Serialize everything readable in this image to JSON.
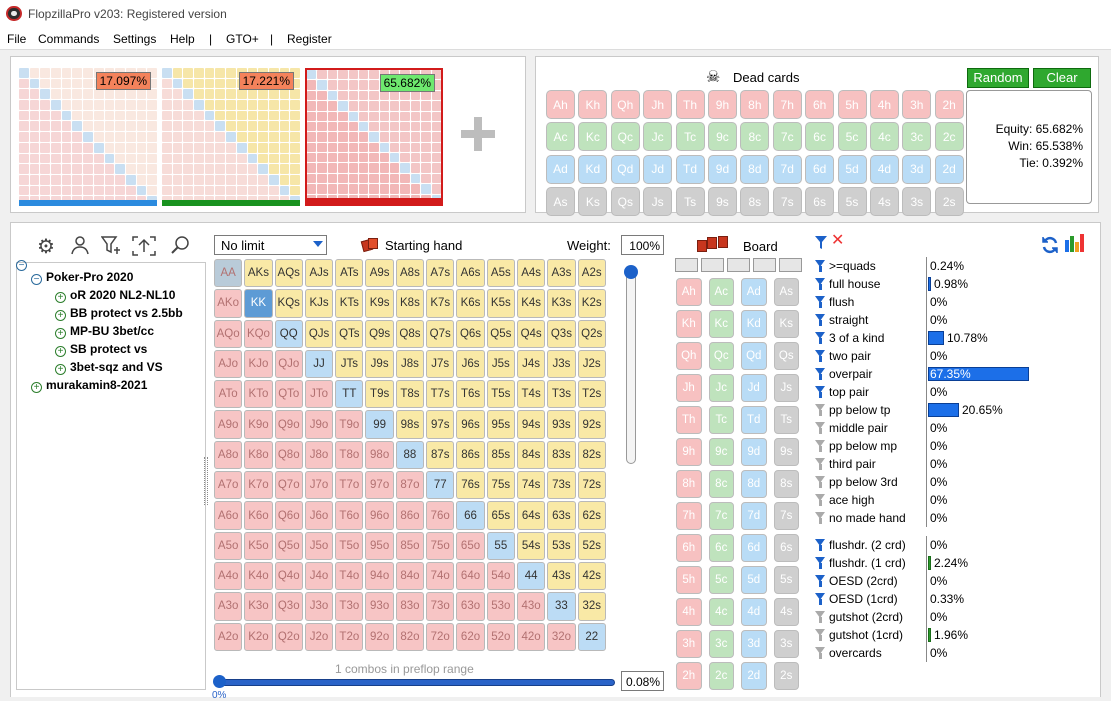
{
  "app": {
    "title": "FlopzillaPro v203: Registered version"
  },
  "menu": [
    "File",
    "Commands",
    "Settings",
    "Help",
    "|",
    "GTO+",
    "|",
    "Register"
  ],
  "ranges": [
    {
      "pct": "17.097%",
      "pct_bg": "#f4825b",
      "bar_color": "#2b8bdf"
    },
    {
      "pct": "17.221%",
      "pct_bg": "#f4825b",
      "bar_color": "#19921f"
    },
    {
      "pct": "65.682%",
      "pct_bg": "#6ee86e",
      "bar_color": "#d21b1b"
    }
  ],
  "dead_cards": {
    "title": "Dead cards",
    "random": "Random",
    "clear": "Clear",
    "ranks": [
      "A",
      "K",
      "Q",
      "J",
      "T",
      "9",
      "8",
      "7",
      "6",
      "5",
      "4",
      "3",
      "2"
    ],
    "suits": [
      "h",
      "c",
      "d",
      "s"
    ]
  },
  "equity": {
    "equity": "Equity: 65.682%",
    "win": "Win: 65.538%",
    "tie": "Tie: 0.392%"
  },
  "tree": {
    "items": [
      {
        "label": "Poker-Pro 2020",
        "expanded": true
      },
      {
        "label": "oR 2020 NL2-NL10"
      },
      {
        "label": "BB protect vs 2.5bb"
      },
      {
        "label": "MP-BU 3bet/cc"
      },
      {
        "label": "SB protect vs"
      },
      {
        "label": "3bet-sqz and VS"
      },
      {
        "label": "murakamin8-2021"
      }
    ]
  },
  "limit": {
    "value": "No limit"
  },
  "starting_hand": {
    "title": "Starting hand",
    "weight_label": "Weight:",
    "weight": "100%",
    "combos": "1 combos in preflop range",
    "zoom": "0.08%",
    "slider": "0%"
  },
  "board": {
    "title": "Board"
  },
  "stats": [
    {
      "name": ">=quads",
      "value": "0.24%",
      "pct": 0.24,
      "active": true
    },
    {
      "name": "full house",
      "value": "0.98%",
      "pct": 0.98,
      "active": true
    },
    {
      "name": "flush",
      "value": "0%",
      "pct": 0,
      "active": true
    },
    {
      "name": "straight",
      "value": "0%",
      "pct": 0,
      "active": true
    },
    {
      "name": "3 of a kind",
      "value": "10.78%",
      "pct": 10.78,
      "active": true
    },
    {
      "name": "two pair",
      "value": "0%",
      "pct": 0,
      "active": true
    },
    {
      "name": "overpair",
      "value": "67.35%",
      "pct": 67.35,
      "active": true,
      "inside": true
    },
    {
      "name": "top pair",
      "value": "0%",
      "pct": 0,
      "active": true
    },
    {
      "name": "pp below tp",
      "value": "20.65%",
      "pct": 20.65,
      "active": false
    },
    {
      "name": "middle pair",
      "value": "0%",
      "pct": 0,
      "active": false
    },
    {
      "name": "pp below mp",
      "value": "0%",
      "pct": 0,
      "active": false
    },
    {
      "name": "third pair",
      "value": "0%",
      "pct": 0,
      "active": false
    },
    {
      "name": "pp below 3rd",
      "value": "0%",
      "pct": 0,
      "active": false
    },
    {
      "name": "ace high",
      "value": "0%",
      "pct": 0,
      "active": false
    },
    {
      "name": "no made hand",
      "value": "0%",
      "pct": 0,
      "active": false
    }
  ],
  "draws": [
    {
      "name": "flushdr. (2 crd)",
      "value": "0%",
      "pct": 0,
      "active": true
    },
    {
      "name": "flushdr. (1 crd)",
      "value": "2.24%",
      "pct": 2.24,
      "active": true
    },
    {
      "name": "OESD (2crd)",
      "value": "0%",
      "pct": 0,
      "active": true
    },
    {
      "name": "OESD (1crd)",
      "value": "0.33%",
      "pct": 0.33,
      "active": true
    },
    {
      "name": "gutshot (2crd)",
      "value": "0%",
      "pct": 0,
      "active": false
    },
    {
      "name": "gutshot (1crd)",
      "value": "1.96%",
      "pct": 1.96,
      "active": false
    },
    {
      "name": "overcards",
      "value": "0%",
      "pct": 0,
      "active": false
    }
  ],
  "colors": {
    "suited": "#f9e9a6",
    "offsuit": "#f7c5c5",
    "pair": "#bcdcf5",
    "selected": "#5d9bd5",
    "accent": "#1c6fe8"
  }
}
